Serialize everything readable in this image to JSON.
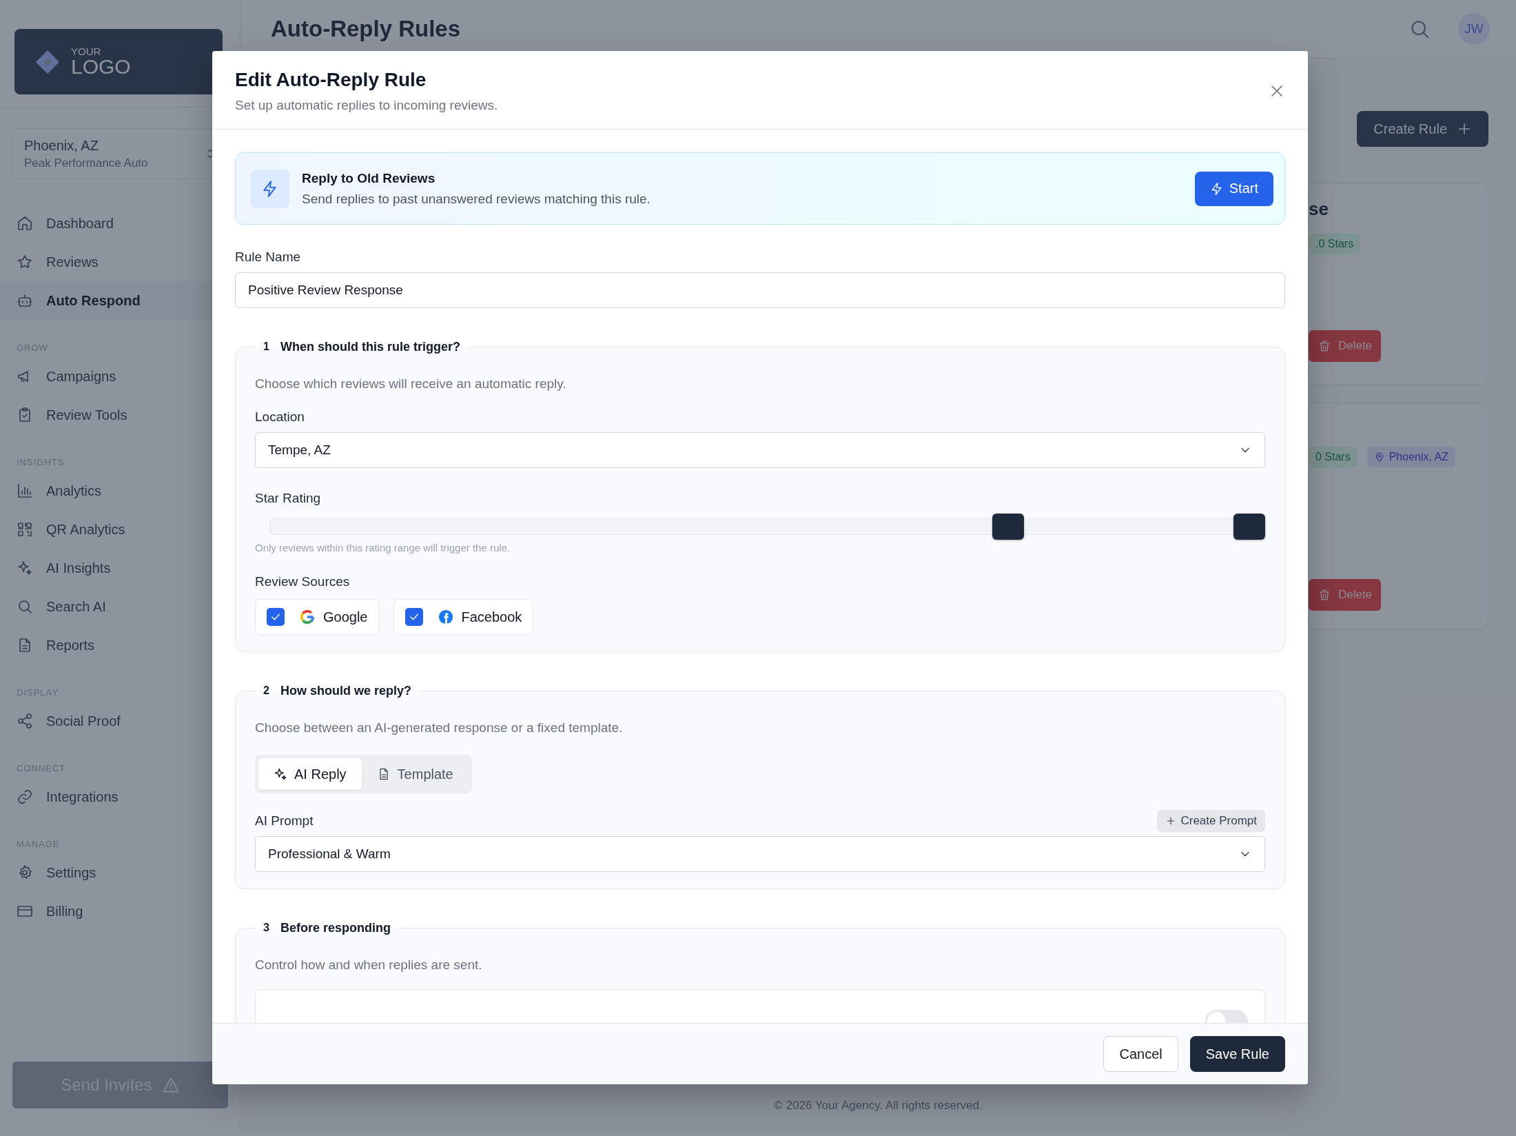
{
  "sidebar": {
    "logo": {
      "small": "YOUR",
      "big": "LOGO"
    },
    "location": {
      "name": "Phoenix, AZ",
      "business": "Peak Performance Auto"
    },
    "nav": [
      {
        "kind": "item",
        "label": "Dashboard",
        "selected": false
      },
      {
        "kind": "item",
        "label": "Reviews",
        "selected": false
      },
      {
        "kind": "item",
        "label": "Auto Respond",
        "selected": true
      },
      {
        "kind": "section",
        "label": "GROW"
      },
      {
        "kind": "item",
        "label": "Campaigns",
        "selected": false
      },
      {
        "kind": "item",
        "label": "Review Tools",
        "selected": false
      },
      {
        "kind": "section",
        "label": "INSIGHTS"
      },
      {
        "kind": "item",
        "label": "Analytics",
        "selected": false
      },
      {
        "kind": "item",
        "label": "QR Analytics",
        "selected": false
      },
      {
        "kind": "item",
        "label": "AI Insights",
        "selected": false
      },
      {
        "kind": "item",
        "label": "Search AI",
        "selected": false
      },
      {
        "kind": "item",
        "label": "Reports",
        "selected": false
      },
      {
        "kind": "section",
        "label": "DISPLAY"
      },
      {
        "kind": "item",
        "label": "Social Proof",
        "selected": false
      },
      {
        "kind": "section",
        "label": "CONNECT"
      },
      {
        "kind": "item",
        "label": "Integrations",
        "selected": false
      },
      {
        "kind": "section",
        "label": "MANAGE"
      },
      {
        "kind": "item",
        "label": "Settings",
        "selected": false
      },
      {
        "kind": "item",
        "label": "Billing",
        "selected": false
      }
    ],
    "send_button": "Send Invites"
  },
  "header": {
    "title": "Auto-Reply Rules",
    "avatar": "JW"
  },
  "create_button": "Create Rule",
  "rule_cards": [
    {
      "title": "se",
      "tags": [
        {
          "kind": "stars",
          "label": ".0 Stars"
        }
      ],
      "delete_button": "Delete"
    },
    {
      "tags": [
        {
          "kind": "stars",
          "label": "0 Stars"
        },
        {
          "kind": "location",
          "label": "Phoenix, AZ"
        }
      ],
      "delete_button": "Delete"
    }
  ],
  "footer": "© 2026 Your Agency. All rights reserved.",
  "modal": {
    "title": "Edit Auto-Reply Rule",
    "subtitle": "Set up automatic replies to incoming reviews.",
    "banner": {
      "title": "Reply to Old Reviews",
      "text": "Send replies to past unanswered reviews matching this rule.",
      "button": "Start"
    },
    "rule_name": {
      "label": "Rule Name",
      "value": "Positive Review Response"
    },
    "trigger": {
      "number": "1",
      "title": "When should this rule trigger?",
      "description": "Choose which reviews will receive an automatic reply.",
      "location": {
        "label": "Location",
        "value": "Tempe, AZ"
      },
      "star_rating": {
        "label": "Star Rating",
        "thumbs": [
          {
            "level": 0.75
          },
          {
            "level": 1
          }
        ],
        "hint": "Only reviews within this rating range will trigger the rule."
      },
      "sources": {
        "label": "Review Sources",
        "items": [
          {
            "kind": "google",
            "label": "Google",
            "checked": true
          },
          {
            "kind": "facebook",
            "label": "Facebook",
            "checked": true
          }
        ]
      }
    },
    "reply": {
      "number": "2",
      "title": "How should we reply?",
      "description": "Choose between an AI-generated response or a fixed template.",
      "modes": [
        {
          "kind": "ai",
          "label": "AI Reply",
          "selected": true
        },
        {
          "kind": "template",
          "label": "Template",
          "selected": false
        }
      ],
      "prompt": {
        "label": "AI Prompt",
        "create_button": "Create Prompt",
        "value": "Professional & Warm"
      }
    },
    "before": {
      "number": "3",
      "title": "Before responding",
      "description": "Control how and when replies are sent.",
      "settings": [
        {
          "on": false
        }
      ]
    },
    "cancel_button": "Cancel",
    "save_button": "Save Rule"
  }
}
